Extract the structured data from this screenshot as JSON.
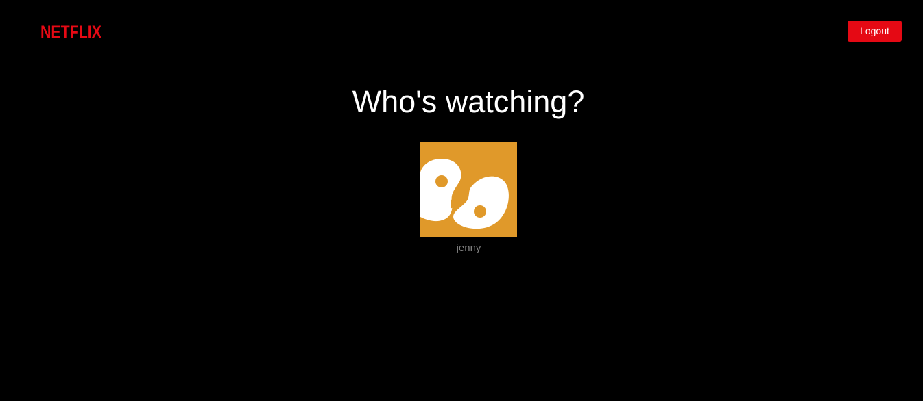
{
  "header": {
    "logo_text": "NETFLIX",
    "logout_label": "Logout"
  },
  "main": {
    "title": "Who's watching?",
    "profiles": [
      {
        "name": "jenny",
        "avatar_icon": "smiley-face-icon"
      }
    ]
  },
  "colors": {
    "background": "#000000",
    "brand_red": "#e50914",
    "avatar_orange": "#e0992a",
    "profile_name": "#808080"
  }
}
